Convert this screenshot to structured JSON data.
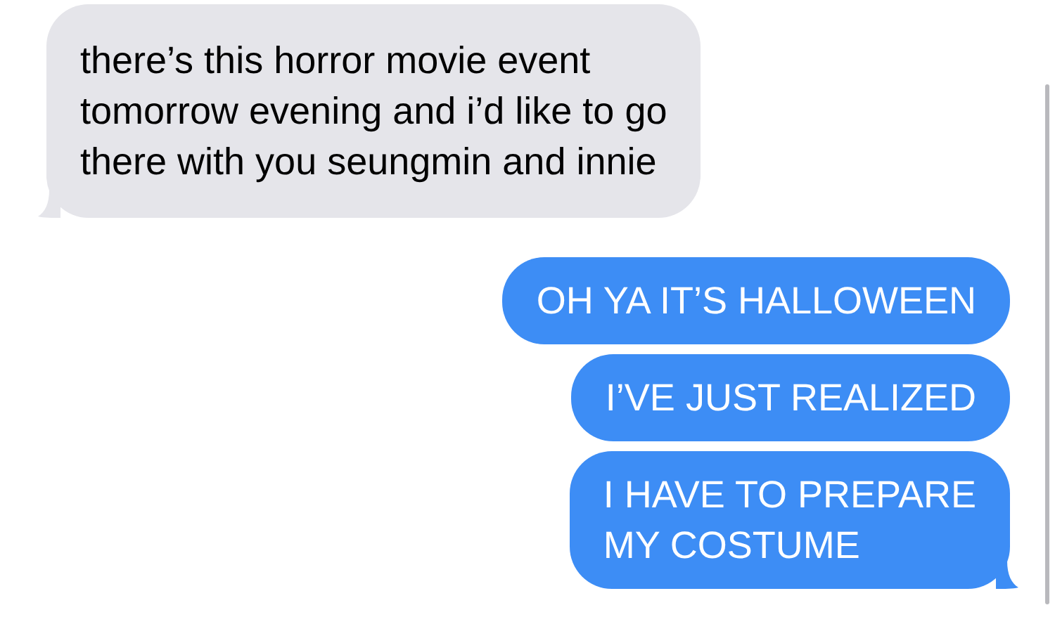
{
  "messages": [
    {
      "kind": "received",
      "lines": [
        "there’s this horror movie event",
        "tomorrow evening and i’d like to go",
        "there with you seungmin and innie"
      ],
      "tail": true
    },
    {
      "kind": "sent",
      "lines": [
        "OH YA IT’S HALLOWEEN"
      ],
      "tail": false
    },
    {
      "kind": "sent",
      "lines": [
        "I’VE JUST REALIZED"
      ],
      "tail": false
    },
    {
      "kind": "sent",
      "lines": [
        "I HAVE TO PREPARE",
        "MY COSTUME"
      ],
      "tail": true
    }
  ]
}
